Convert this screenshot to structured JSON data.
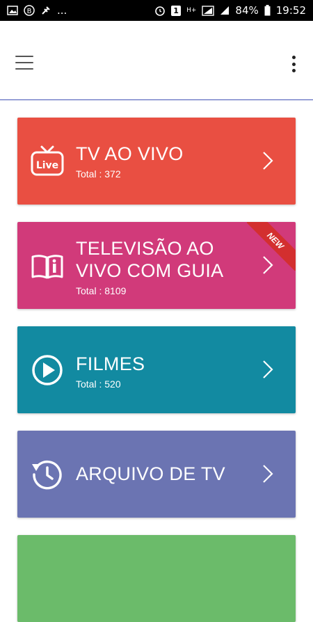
{
  "status_bar": {
    "battery": "84%",
    "time": "19:52",
    "notification_badge": "1",
    "network": "H+",
    "overflow": "..."
  },
  "app_bar": {
    "menu_icon": "hamburger-menu-icon",
    "more_icon": "more-vertical-icon"
  },
  "cards": [
    {
      "title": "TV AO VIVO",
      "total": "Total : 372",
      "color": "#e94f42",
      "icon": "live-tv-icon"
    },
    {
      "title": "TELEVISÃO AO VIVO COM GUIA",
      "total": "Total : 8109",
      "color": "#d13a7a",
      "icon": "guide-book-icon",
      "badge": "NEW"
    },
    {
      "title": "FILMES",
      "total": "Total : 520",
      "color": "#128aa1",
      "icon": "play-circle-icon"
    },
    {
      "title": "ARQUIVO DE TV",
      "color": "#6b74b2",
      "icon": "history-icon"
    },
    {
      "color": "#6bbb6a"
    }
  ]
}
